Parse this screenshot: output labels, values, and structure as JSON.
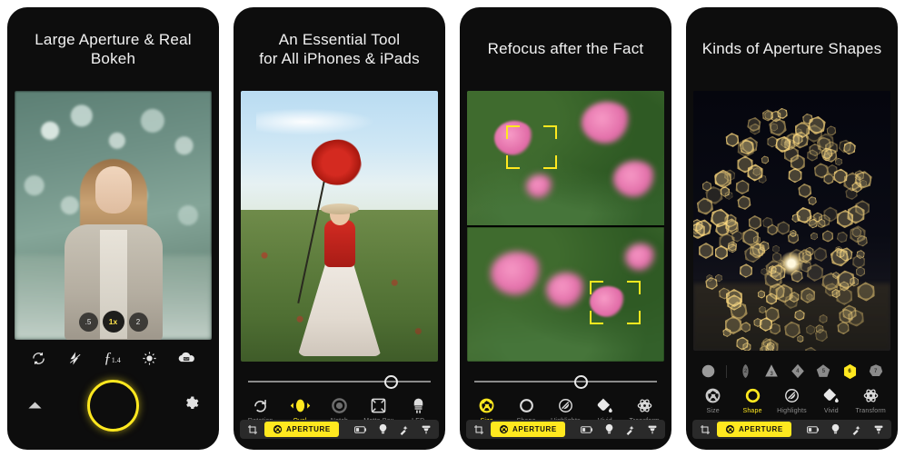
{
  "gallery": {
    "panels": [
      {
        "id": "panel-large-aperture",
        "title": "Large Aperture & Real Bokeh",
        "zoom_buttons": [
          {
            "label": ".5",
            "active": false
          },
          {
            "label": "1x",
            "active": true
          },
          {
            "label": "2",
            "active": false
          }
        ],
        "camera_icons": [
          {
            "name": "flip-camera-icon",
            "label": "Flip Camera"
          },
          {
            "name": "flash-off-icon",
            "label": "Flash Off"
          },
          {
            "name": "aperture-value-icon",
            "label": "ƒ 1.4"
          },
          {
            "name": "brightness-icon",
            "label": "Brightness"
          },
          {
            "name": "hdr-icon",
            "label": "HDR"
          }
        ],
        "aperture_value": "1.4",
        "aperture_prefix": "ƒ",
        "shutter_label": "Shutter",
        "chevron_label": "Expand",
        "settings_label": "Settings"
      },
      {
        "id": "panel-essential-tool",
        "title_line1": "An Essential Tool",
        "title_line2": "for All iPhones & iPads",
        "slider": {
          "value": 78,
          "name": "bokeh-intensity-slider"
        },
        "tools": [
          {
            "label": "Rotation",
            "icon": "rotation-icon",
            "active": false
          },
          {
            "label": "Oval",
            "icon": "oval-icon",
            "active": true
          },
          {
            "label": "Notch",
            "icon": "notch-icon",
            "active": false
          },
          {
            "label": "Matte Box",
            "icon": "matte-box-icon",
            "active": false
          },
          {
            "label": "LED",
            "icon": "led-icon",
            "active": false
          }
        ]
      },
      {
        "id": "panel-refocus",
        "title": "Refocus after the Fact",
        "slider": {
          "value": 58,
          "name": "focus-distance-slider"
        },
        "tools": [
          {
            "label": "Size",
            "icon": "size-aperture-icon",
            "active": true
          },
          {
            "label": "Shape",
            "icon": "shape-circle-icon",
            "active": false
          },
          {
            "label": "Highlights",
            "icon": "highlights-icon",
            "active": false
          },
          {
            "label": "Vivid",
            "icon": "vivid-paint-icon",
            "active": false
          },
          {
            "label": "Transform",
            "icon": "transform-icon",
            "active": false
          }
        ]
      },
      {
        "id": "panel-aperture-shapes",
        "title": "Kinds of Aperture Shapes",
        "shapes": [
          {
            "label": "",
            "sides": 0,
            "active": false,
            "name": "shape-circle"
          },
          {
            "label": "2",
            "sides": 2,
            "active": false,
            "name": "shape-2-sided"
          },
          {
            "label": "3",
            "sides": 3,
            "active": false,
            "name": "shape-triangle"
          },
          {
            "label": "4",
            "sides": 4,
            "active": false,
            "name": "shape-diamond"
          },
          {
            "label": "5",
            "sides": 5,
            "active": false,
            "name": "shape-pentagon"
          },
          {
            "label": "6",
            "sides": 6,
            "active": true,
            "name": "shape-hexagon"
          },
          {
            "label": "7",
            "sides": 7,
            "active": false,
            "name": "shape-heptagon"
          }
        ],
        "tools": [
          {
            "label": "Size",
            "icon": "size-aperture-icon",
            "active": false
          },
          {
            "label": "Shape",
            "icon": "shape-circle-icon",
            "active": true
          },
          {
            "label": "Highlights",
            "icon": "highlights-icon",
            "active": false
          },
          {
            "label": "Vivid",
            "icon": "vivid-paint-icon",
            "active": false
          },
          {
            "label": "Transform",
            "icon": "transform-icon",
            "active": false
          }
        ]
      }
    ],
    "bottom_bar": {
      "crop_label": "Crop",
      "aperture_label": "APERTURE",
      "exposure_label": "Exposure",
      "bulb_label": "Bulb",
      "wand_label": "Wand",
      "brush_label": "Brush"
    },
    "colors": {
      "accent_yellow": "#ffe81f",
      "panel_bg": "#0d0d0d",
      "label_grey": "#8e8e8e",
      "page_bg": "#ffffff"
    }
  }
}
